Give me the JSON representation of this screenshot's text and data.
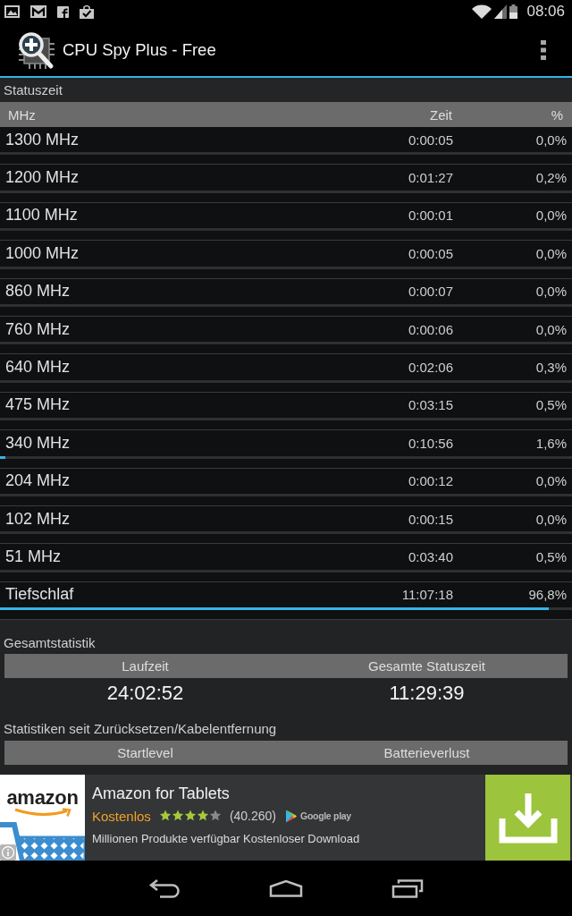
{
  "status_bar": {
    "time": "08:06"
  },
  "app_bar": {
    "title": "CPU Spy Plus - Free"
  },
  "state_times": {
    "heading": "Statuszeit",
    "columns": [
      "MHz",
      "Zeit",
      "%"
    ],
    "rows": [
      {
        "frequency": "1300 MHz",
        "time": "0:00:05",
        "percent": "0,0%"
      },
      {
        "frequency": "1200 MHz",
        "time": "0:01:27",
        "percent": "0,2%"
      },
      {
        "frequency": "1100 MHz",
        "time": "0:00:01",
        "percent": "0,0%"
      },
      {
        "frequency": "1000 MHz",
        "time": "0:00:05",
        "percent": "0,0%"
      },
      {
        "frequency": "860 MHz",
        "time": "0:00:07",
        "percent": "0,0%"
      },
      {
        "frequency": "760 MHz",
        "time": "0:00:06",
        "percent": "0,0%"
      },
      {
        "frequency": "640 MHz",
        "time": "0:02:06",
        "percent": "0,3%"
      },
      {
        "frequency": "475 MHz",
        "time": "0:03:15",
        "percent": "0,5%"
      },
      {
        "frequency": "340 MHz",
        "time": "0:10:56",
        "percent": "1,6%",
        "level": 0.01
      },
      {
        "frequency": "204 MHz",
        "time": "0:00:12",
        "percent": "0,0%"
      },
      {
        "frequency": "102 MHz",
        "time": "0:00:15",
        "percent": "0,0%"
      },
      {
        "frequency": "51 MHz",
        "time": "0:03:40",
        "percent": "0,5%"
      },
      {
        "frequency": "Tiefschlaf",
        "time": "11:07:18",
        "percent": "96,8%",
        "level": 0.96
      }
    ]
  },
  "total_stats": {
    "heading": "Gesamtstatistik",
    "columns": [
      {
        "label": "Laufzeit",
        "value": "24:02:52"
      },
      {
        "label": "Gesamte Statuszeit",
        "value": "11:29:39"
      }
    ]
  },
  "since_reset": {
    "heading": "Statistiken seit Zurücksetzen/Kabelentfernung",
    "columns": [
      {
        "label": "Startlevel"
      },
      {
        "label": "Batterieverlust"
      }
    ]
  },
  "ad": {
    "logo": "amazon",
    "title": "Amazon for Tablets",
    "price": "Kostenlos",
    "stars": 4,
    "rating_count": "(40.260)",
    "store": "Google play",
    "description": "Millionen Produkte verfügbar Kostenloser Download"
  }
}
